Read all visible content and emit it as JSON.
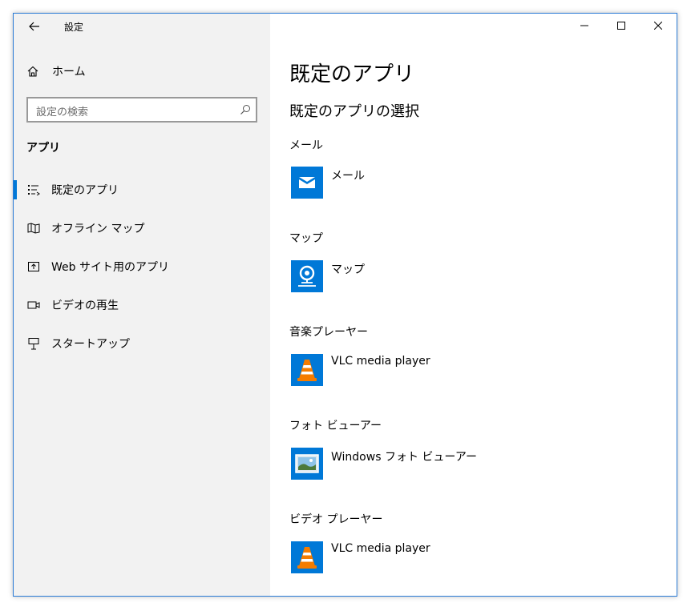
{
  "window": {
    "title": "設定"
  },
  "sidebar": {
    "home_label": "ホーム",
    "search_placeholder": "設定の検索",
    "section_title": "アプリ",
    "items": [
      {
        "label": "既定のアプリ",
        "icon": "default-apps-icon",
        "active": true
      },
      {
        "label": "オフライン マップ",
        "icon": "offline-map-icon",
        "active": false
      },
      {
        "label": "Web サイト用のアプリ",
        "icon": "website-apps-icon",
        "active": false
      },
      {
        "label": "ビデオの再生",
        "icon": "video-icon",
        "active": false
      },
      {
        "label": "スタートアップ",
        "icon": "startup-icon",
        "active": false
      }
    ]
  },
  "main": {
    "title": "既定のアプリ",
    "subtitle": "既定のアプリの選択",
    "categories": [
      {
        "label": "メール",
        "app": "メール",
        "icon": "mail-app-icon"
      },
      {
        "label": "マップ",
        "app": "マップ",
        "icon": "maps-app-icon"
      },
      {
        "label": "音楽プレーヤー",
        "app": "VLC media player",
        "icon": "vlc-icon"
      },
      {
        "label": "フォト ビューアー",
        "app": "Windows フォト ビューアー",
        "icon": "photo-viewer-icon"
      },
      {
        "label": "ビデオ プレーヤー",
        "app": "VLC media player",
        "icon": "vlc-icon"
      }
    ]
  },
  "colors": {
    "accent": "#0078d7",
    "sidebar_bg": "#f2f2f2",
    "border": "#2b7bd6"
  }
}
